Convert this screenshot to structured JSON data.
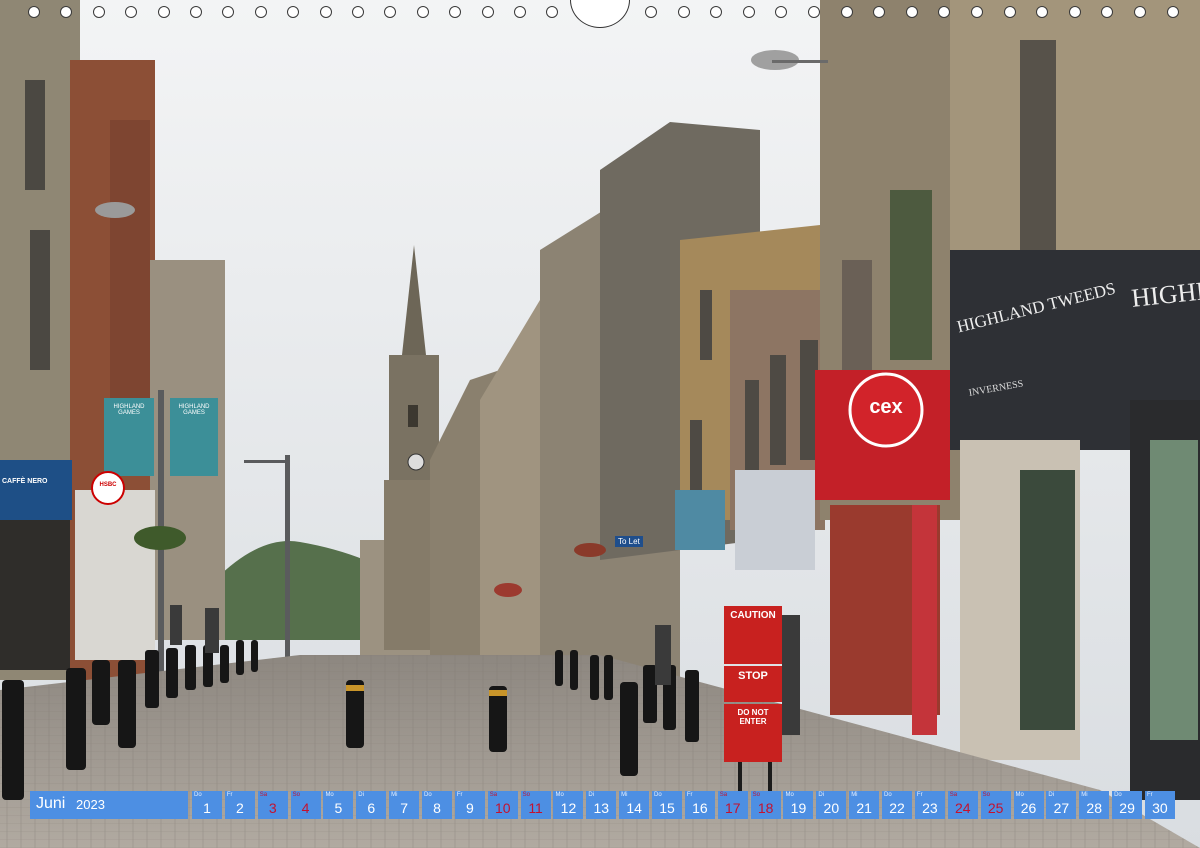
{
  "calendar": {
    "month": "Juni",
    "year": "2023",
    "days": [
      {
        "wd": "Do",
        "num": "1",
        "weekend": false
      },
      {
        "wd": "Fr",
        "num": "2",
        "weekend": false
      },
      {
        "wd": "Sa",
        "num": "3",
        "weekend": true
      },
      {
        "wd": "So",
        "num": "4",
        "weekend": true
      },
      {
        "wd": "Mo",
        "num": "5",
        "weekend": false
      },
      {
        "wd": "Di",
        "num": "6",
        "weekend": false
      },
      {
        "wd": "Mi",
        "num": "7",
        "weekend": false
      },
      {
        "wd": "Do",
        "num": "8",
        "weekend": false
      },
      {
        "wd": "Fr",
        "num": "9",
        "weekend": false
      },
      {
        "wd": "Sa",
        "num": "10",
        "weekend": true
      },
      {
        "wd": "So",
        "num": "11",
        "weekend": true
      },
      {
        "wd": "Mo",
        "num": "12",
        "weekend": false
      },
      {
        "wd": "Di",
        "num": "13",
        "weekend": false
      },
      {
        "wd": "Mi",
        "num": "14",
        "weekend": false
      },
      {
        "wd": "Do",
        "num": "15",
        "weekend": false
      },
      {
        "wd": "Fr",
        "num": "16",
        "weekend": false
      },
      {
        "wd": "Sa",
        "num": "17",
        "weekend": true
      },
      {
        "wd": "So",
        "num": "18",
        "weekend": true
      },
      {
        "wd": "Mo",
        "num": "19",
        "weekend": false
      },
      {
        "wd": "Di",
        "num": "20",
        "weekend": false
      },
      {
        "wd": "Mi",
        "num": "21",
        "weekend": false
      },
      {
        "wd": "Do",
        "num": "22",
        "weekend": false
      },
      {
        "wd": "Fr",
        "num": "23",
        "weekend": false
      },
      {
        "wd": "Sa",
        "num": "24",
        "weekend": true
      },
      {
        "wd": "So",
        "num": "25",
        "weekend": true
      },
      {
        "wd": "Mo",
        "num": "26",
        "weekend": false
      },
      {
        "wd": "Di",
        "num": "27",
        "weekend": false
      },
      {
        "wd": "Mi",
        "num": "28",
        "weekend": false
      },
      {
        "wd": "Do",
        "num": "29",
        "weekend": false
      },
      {
        "wd": "Fr",
        "num": "30",
        "weekend": false
      }
    ]
  },
  "signs": {
    "shop_left": "HIGHLAND TWEEDS",
    "shop_left_sub": "INVERNESS",
    "shop_right": "HIGHL",
    "cex": "cex",
    "caution": "CAUTION",
    "stop": "STOP",
    "do_not_enter": "DO NOT ENTER",
    "hsbc": "HSBC",
    "caffe_nero": "CAFFÈ NERO",
    "banner": "HIGHLAND GAMES",
    "to_let": "To Let"
  },
  "colors": {
    "accent": "#4d8fe3",
    "weekend": "#c4122f",
    "cex_red": "#d2232a"
  }
}
